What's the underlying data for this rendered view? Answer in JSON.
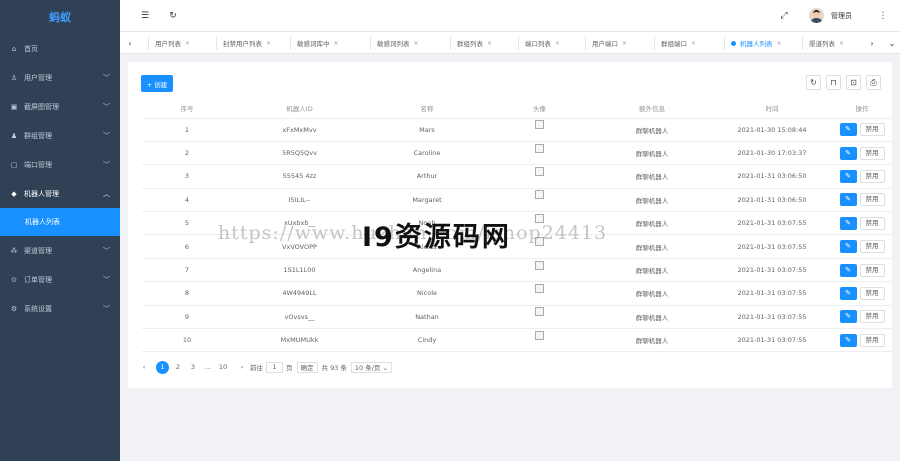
{
  "app": {
    "logo": "蚂蚁"
  },
  "sidebar": {
    "items": [
      {
        "label": "首页",
        "icon": "home-icon",
        "glyph": "⌂",
        "has_children": false
      },
      {
        "label": "用户管理",
        "icon": "user-icon",
        "glyph": "♙",
        "has_children": true
      },
      {
        "label": "截屏图管理",
        "icon": "image-icon",
        "glyph": "▣",
        "has_children": true
      },
      {
        "label": "群组管理",
        "icon": "group-icon",
        "glyph": "♟",
        "has_children": true
      },
      {
        "label": "端口管理",
        "icon": "port-icon",
        "glyph": "▢",
        "has_children": true
      },
      {
        "label": "机器人管理",
        "icon": "robot-icon",
        "glyph": "◆",
        "has_children": true,
        "open": true
      },
      {
        "label": "机器人列表",
        "icon": "",
        "glyph": "",
        "sub": true,
        "active": true
      },
      {
        "label": "渠道管理",
        "icon": "channel-icon",
        "glyph": "⁂",
        "has_children": true
      },
      {
        "label": "订单管理",
        "icon": "order-icon",
        "glyph": "⊙",
        "has_children": true
      },
      {
        "label": "系统设置",
        "icon": "settings-icon",
        "glyph": "⚙",
        "has_children": true
      }
    ]
  },
  "navbar": {
    "username": "管理员"
  },
  "tabs": [
    {
      "label": "用户列表",
      "active": false
    },
    {
      "label": "封禁用户列表",
      "active": false
    },
    {
      "label": "敏感词库中",
      "active": false
    },
    {
      "label": "敏感词列表",
      "active": false
    },
    {
      "label": "群组列表",
      "active": false
    },
    {
      "label": "端口列表",
      "active": false
    },
    {
      "label": "用户端口",
      "active": false
    },
    {
      "label": "群组端口",
      "active": false
    },
    {
      "label": "机器人列表",
      "active": true
    },
    {
      "label": "渠道列表",
      "active": false
    }
  ],
  "toolbar": {
    "create_label": "+ 创建"
  },
  "table": {
    "headers": [
      "序号",
      "机器人ID",
      "名称",
      "头像",
      "额外信息",
      "时间",
      "操作"
    ],
    "rows": [
      [
        "1",
        "xFxMxMvv",
        "Mars",
        "群聊机器人",
        "2021-01-30 15:08:44"
      ],
      [
        "2",
        "5R5Q5Qvv",
        "Caroline",
        "群聊机器人",
        "2021-01-30 17:03:37"
      ],
      [
        "3",
        "55545 4zz",
        "Arthur",
        "群聊机器人",
        "2021-01-31 03:06:50"
      ],
      [
        "4",
        "I5ILIL--",
        "Margaret",
        "群聊机器人",
        "2021-01-31 03:06:50"
      ],
      [
        "5",
        "xUxbxb__",
        "Noah",
        "群聊机器人",
        "2021-01-31 03:07:55"
      ],
      [
        "6",
        "VxVOVOPP",
        "Alexis",
        "群聊机器人",
        "2021-01-31 03:07:55"
      ],
      [
        "7",
        "1S1L1L00",
        "Angelina",
        "群聊机器人",
        "2021-01-31 03:07:55"
      ],
      [
        "8",
        "4W4949LL",
        "Nicole",
        "群聊机器人",
        "2021-01-31 03:07:55"
      ],
      [
        "9",
        "vOvsvs__",
        "Nathan",
        "群聊机器人",
        "2021-01-31 03:07:55"
      ],
      [
        "10",
        "MxMUMUkk",
        "Cindy",
        "群聊机器人",
        "2021-01-31 03:07:55"
      ]
    ],
    "edit_label": "✎",
    "ban_label": "禁用"
  },
  "pagination": {
    "prev": "‹",
    "pages": [
      "1",
      "2",
      "3",
      "...",
      "10"
    ],
    "current": "1",
    "next": "›",
    "goto_label": "前往",
    "goto_value": "1",
    "page_unit": "页",
    "confirm_label": "确定",
    "total": "共 93 条",
    "page_size": "10 条/页 ⌄"
  },
  "watermark": {
    "url": "https://www.huzhan.com/ishop24413",
    "logo": "Ι9资源码网"
  }
}
